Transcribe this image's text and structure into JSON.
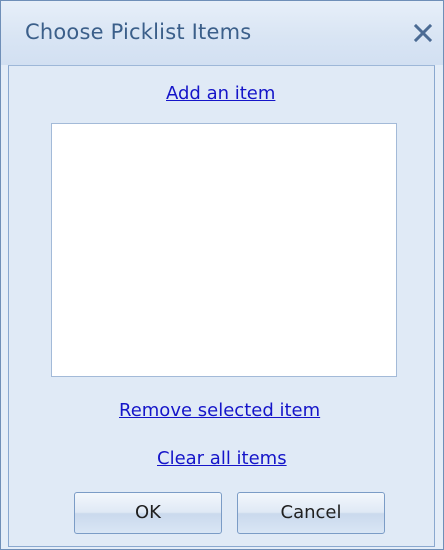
{
  "dialog": {
    "title": "Choose Picklist Items",
    "close_icon": "close-icon",
    "add_link": "Add an item",
    "listbox_items": [],
    "remove_link": "Remove selected item",
    "clear_link": "Clear all items",
    "ok_label": "OK",
    "cancel_label": "Cancel"
  },
  "colors": {
    "title_text": "#3b5f8a",
    "link": "#1515c9",
    "background": "#e0eaf6",
    "border": "#6f8fb8"
  }
}
